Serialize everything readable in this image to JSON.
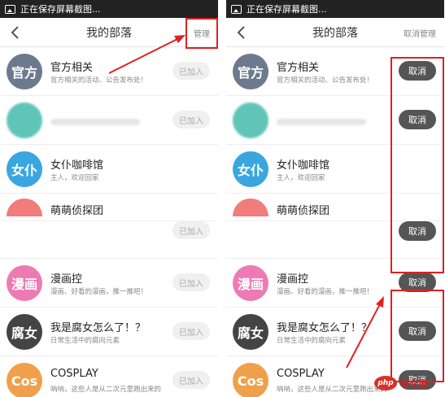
{
  "left": {
    "status": "正在保存屏幕截图...",
    "title": "我的部落",
    "action": "管理",
    "items": [
      {
        "name": "官方相关",
        "desc": "官方相关的活动、公告发布处！",
        "avatar_text": "官方",
        "color": "#6d7a8e",
        "button": "已加入"
      },
      {
        "name": "",
        "desc": "",
        "avatar_text": "",
        "color": "#2bb2a0",
        "button": "已加入"
      },
      {
        "name": "女仆咖啡馆",
        "desc": "主人，欢迎回家",
        "avatar_text": "女仆",
        "color": "#3aa6e0",
        "button": ""
      },
      {
        "name": "萌萌侦探团",
        "desc": "",
        "avatar_text": "",
        "color": "#f07c7c",
        "button": "已加入"
      },
      {
        "name": "漫画控",
        "desc": "漫画、好看的漫画，推一推吧！",
        "avatar_text": "漫画",
        "color": "#ee7ab4",
        "button": "已加入"
      },
      {
        "name": "我是腐女怎么了！？",
        "desc": "日常生活中的腐向元素",
        "avatar_text": "腐女",
        "color": "#444444",
        "button": "已加入"
      },
      {
        "name": "COSPLAY",
        "desc": "呐呐，这些人是从二次元里跑出来的",
        "avatar_text": "Cos",
        "color": "#f0a04a",
        "button": "已加入"
      }
    ]
  },
  "right": {
    "status": "正在保存屏幕截图...",
    "title": "我的部落",
    "action": "取消管理",
    "items": [
      {
        "name": "官方相关",
        "desc": "官方相关的活动、公告发布处！",
        "avatar_text": "官方",
        "color": "#6d7a8e",
        "button": "取消"
      },
      {
        "name": "",
        "desc": "",
        "avatar_text": "",
        "color": "#2bb2a0",
        "button": "取消"
      },
      {
        "name": "女仆咖啡馆",
        "desc": "主人，欢迎回家",
        "avatar_text": "女仆",
        "color": "#3aa6e0",
        "button": ""
      },
      {
        "name": "萌萌侦探团",
        "desc": "",
        "avatar_text": "",
        "color": "#f07c7c",
        "button": "取消"
      },
      {
        "name": "漫画控",
        "desc": "漫画、好看的漫画，推一推吧！",
        "avatar_text": "漫画",
        "color": "#ee7ab4",
        "button": "取消"
      },
      {
        "name": "我是腐女怎么了！？",
        "desc": "日常生活中的腐向元素",
        "avatar_text": "腐女",
        "color": "#444444",
        "button": "取消"
      },
      {
        "name": "COSPLAY",
        "desc": "呐呐，这些人是从二次元里跑出来的",
        "avatar_text": "Cos",
        "color": "#f0a04a",
        "button": "取消"
      }
    ]
  },
  "watermark": {
    "badge": "php",
    "text": "中文网"
  },
  "colors": {
    "annotation_red": "#e02020",
    "cancel_button": "#555555",
    "joined_button": "#f0f0f0"
  }
}
